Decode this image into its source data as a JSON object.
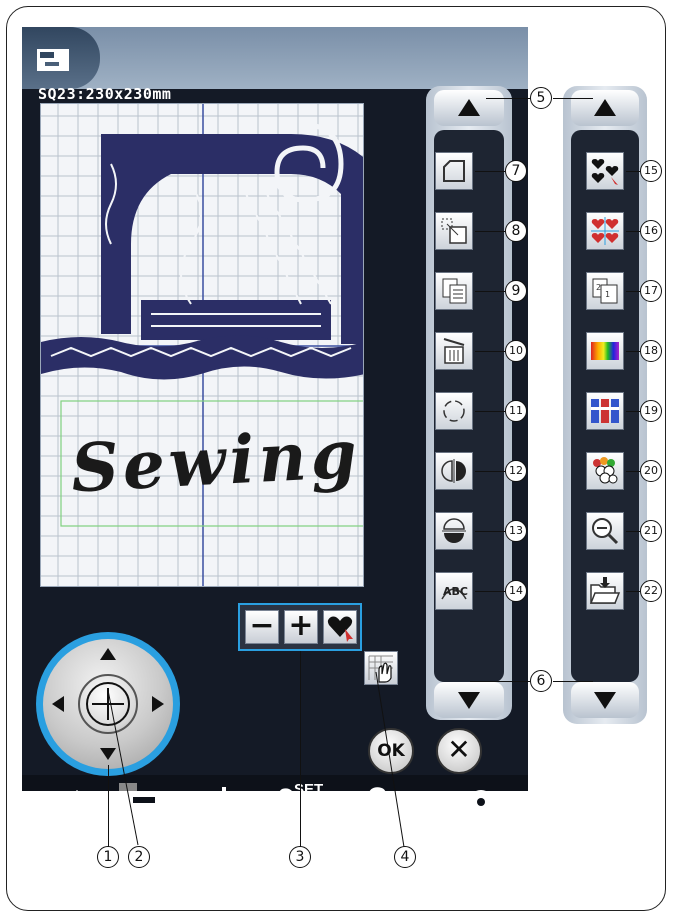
{
  "screen": {
    "size_label": "SQ23:230x230mm",
    "design_text": "Sewing"
  },
  "controls": {
    "minus_label": "−",
    "plus_label": "+",
    "ok_label": "OK",
    "cancel_label": "✕",
    "set_label": "SET",
    "help_label": "?"
  },
  "callouts": {
    "c1": "1",
    "c2": "2",
    "c3": "3",
    "c4": "4",
    "c5": "5",
    "c6": "6",
    "c7": "7",
    "c8": "8",
    "c9": "9",
    "c10": "10",
    "c11": "11",
    "c12": "12",
    "c13": "13",
    "c14": "14",
    "c15": "15",
    "c16": "16",
    "c17": "17",
    "c18": "18",
    "c19": "19",
    "c20": "20",
    "c21": "21",
    "c22": "22"
  },
  "colors": {
    "accent": "#2a9fe0",
    "screen_bg": "#141a26",
    "embroidery": "#2b2e66",
    "text_embroidery": "#1a1a1a",
    "grid": "#b9c2cd",
    "hoop_centerline": "#3b4fa0",
    "text_frame": "#7fd07f"
  },
  "icons": {
    "left_column": [
      "basting-icon",
      "resize-icon",
      "duplicate-icon",
      "delete-icon",
      "rotate-icon",
      "mirror-horizontal-icon",
      "mirror-vertical-icon",
      "arc-text-icon"
    ],
    "right_column": [
      "group-icon",
      "center-icon",
      "layer-order-icon",
      "color-change-icon",
      "color-list-icon",
      "color-grouping-icon",
      "zoom-out-icon",
      "save-file-icon"
    ]
  }
}
